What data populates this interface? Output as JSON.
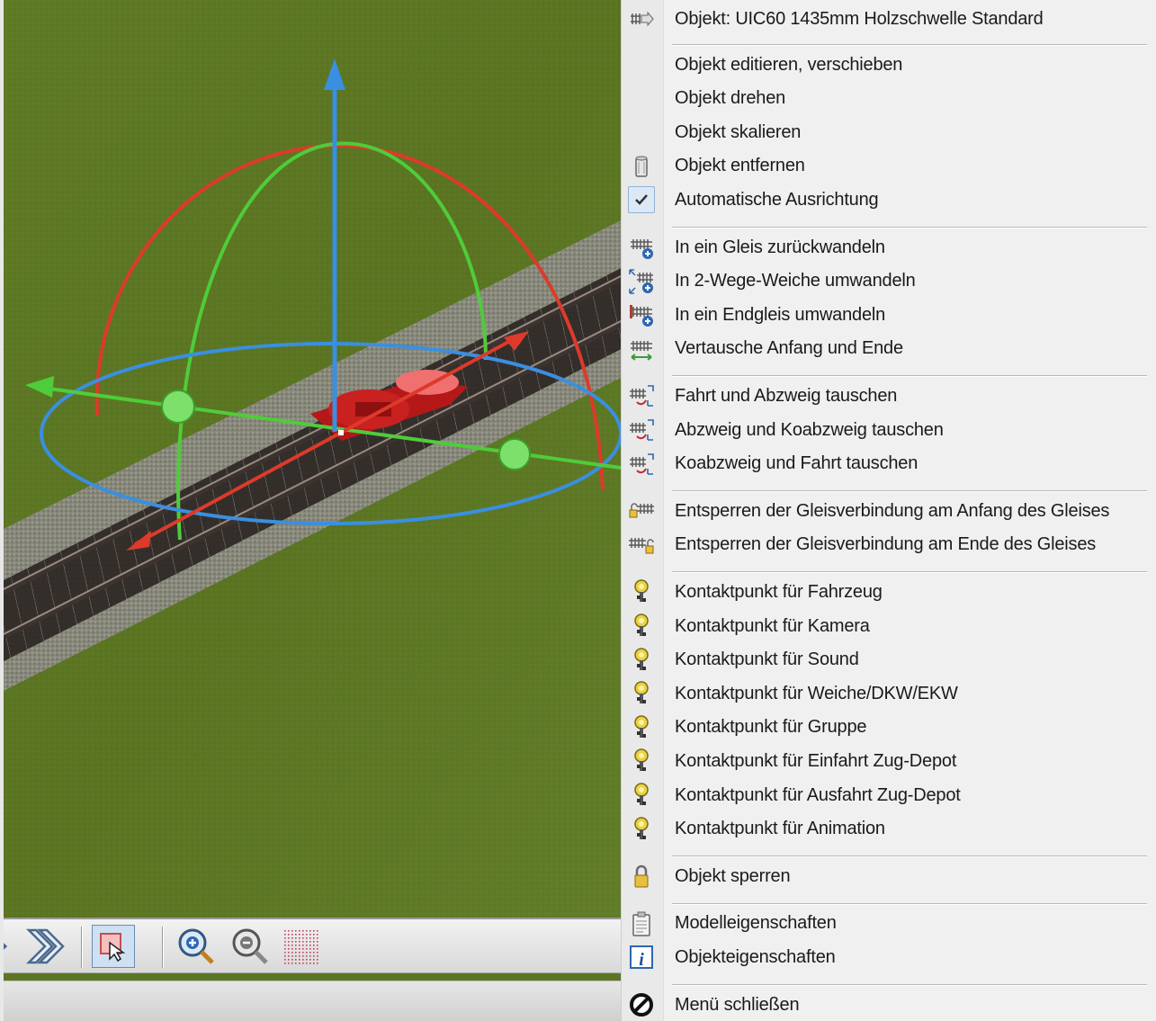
{
  "colors": {
    "grass": "#5c7624",
    "gravel": "#8c8c82",
    "axis_x": "#dd3a2b",
    "axis_y": "#4fcc3a",
    "axis_z": "#3a8fe0",
    "menu_bg": "#f0f0f0"
  },
  "viewport": {
    "toolbar": {
      "buttons": [
        {
          "name": "forward-icon"
        },
        {
          "name": "fast-forward-icon"
        },
        {
          "name": "select-cursor-icon"
        },
        {
          "name": "zoom-in-icon"
        },
        {
          "name": "zoom-out-icon"
        },
        {
          "name": "grid-dots-icon"
        }
      ]
    }
  },
  "menu": {
    "header": {
      "label": "Objekt: UIC60 1435mm Holzschwelle Standard",
      "icon": "track-arrow-icon"
    },
    "groups": [
      {
        "items": [
          {
            "label": "Objekt editieren, verschieben",
            "icon": ""
          },
          {
            "label": "Objekt drehen",
            "icon": ""
          },
          {
            "label": "Objekt skalieren",
            "icon": ""
          },
          {
            "label": "Objekt entfernen",
            "icon": "trash-icon"
          },
          {
            "label": "Automatische Ausrichtung",
            "icon": "check-icon",
            "checked": true
          }
        ]
      },
      {
        "items": [
          {
            "label": "In ein Gleis zurückwandeln",
            "icon": "track-plus-icon"
          },
          {
            "label": "In 2-Wege-Weiche umwandeln",
            "icon": "switch-plus-icon"
          },
          {
            "label": "In ein Endgleis umwandeln",
            "icon": "endtrack-plus-icon"
          },
          {
            "label": "Vertausche Anfang und Ende",
            "icon": "track-swap-icon"
          }
        ]
      },
      {
        "items": [
          {
            "label": "Fahrt und Abzweig tauschen",
            "icon": "branch-swap-icon"
          },
          {
            "label": "Abzweig und Koabzweig tauschen",
            "icon": "branch-swap-icon"
          },
          {
            "label": "Koabzweig und Fahrt tauschen",
            "icon": "branch-swap-icon"
          }
        ]
      },
      {
        "items": [
          {
            "label": "Entsperren der Gleisverbindung am Anfang des Gleises",
            "icon": "unlock-start-icon"
          },
          {
            "label": "Entsperren der Gleisverbindung am Ende des Gleises",
            "icon": "unlock-end-icon"
          }
        ]
      },
      {
        "items": [
          {
            "label": "Kontaktpunkt für Fahrzeug",
            "icon": "contact-point-icon"
          },
          {
            "label": "Kontaktpunkt für Kamera",
            "icon": "contact-point-icon"
          },
          {
            "label": "Kontaktpunkt für Sound",
            "icon": "contact-point-icon"
          },
          {
            "label": "Kontaktpunkt für Weiche/DKW/EKW",
            "icon": "contact-point-icon"
          },
          {
            "label": "Kontaktpunkt für Gruppe",
            "icon": "contact-point-icon"
          },
          {
            "label": "Kontaktpunkt für Einfahrt Zug-Depot",
            "icon": "contact-point-icon"
          },
          {
            "label": "Kontaktpunkt für Ausfahrt Zug-Depot",
            "icon": "contact-point-icon"
          },
          {
            "label": "Kontaktpunkt für Animation",
            "icon": "contact-point-icon"
          }
        ]
      },
      {
        "items": [
          {
            "label": "Objekt sperren",
            "icon": "lock-icon"
          }
        ]
      },
      {
        "items": [
          {
            "label": "Modelleigenschaften",
            "icon": "clipboard-icon"
          },
          {
            "label": "Objekteigenschaften",
            "icon": "info-icon"
          }
        ]
      },
      {
        "items": [
          {
            "label": "Menü schließen",
            "icon": "close-circle-icon"
          }
        ]
      }
    ]
  }
}
